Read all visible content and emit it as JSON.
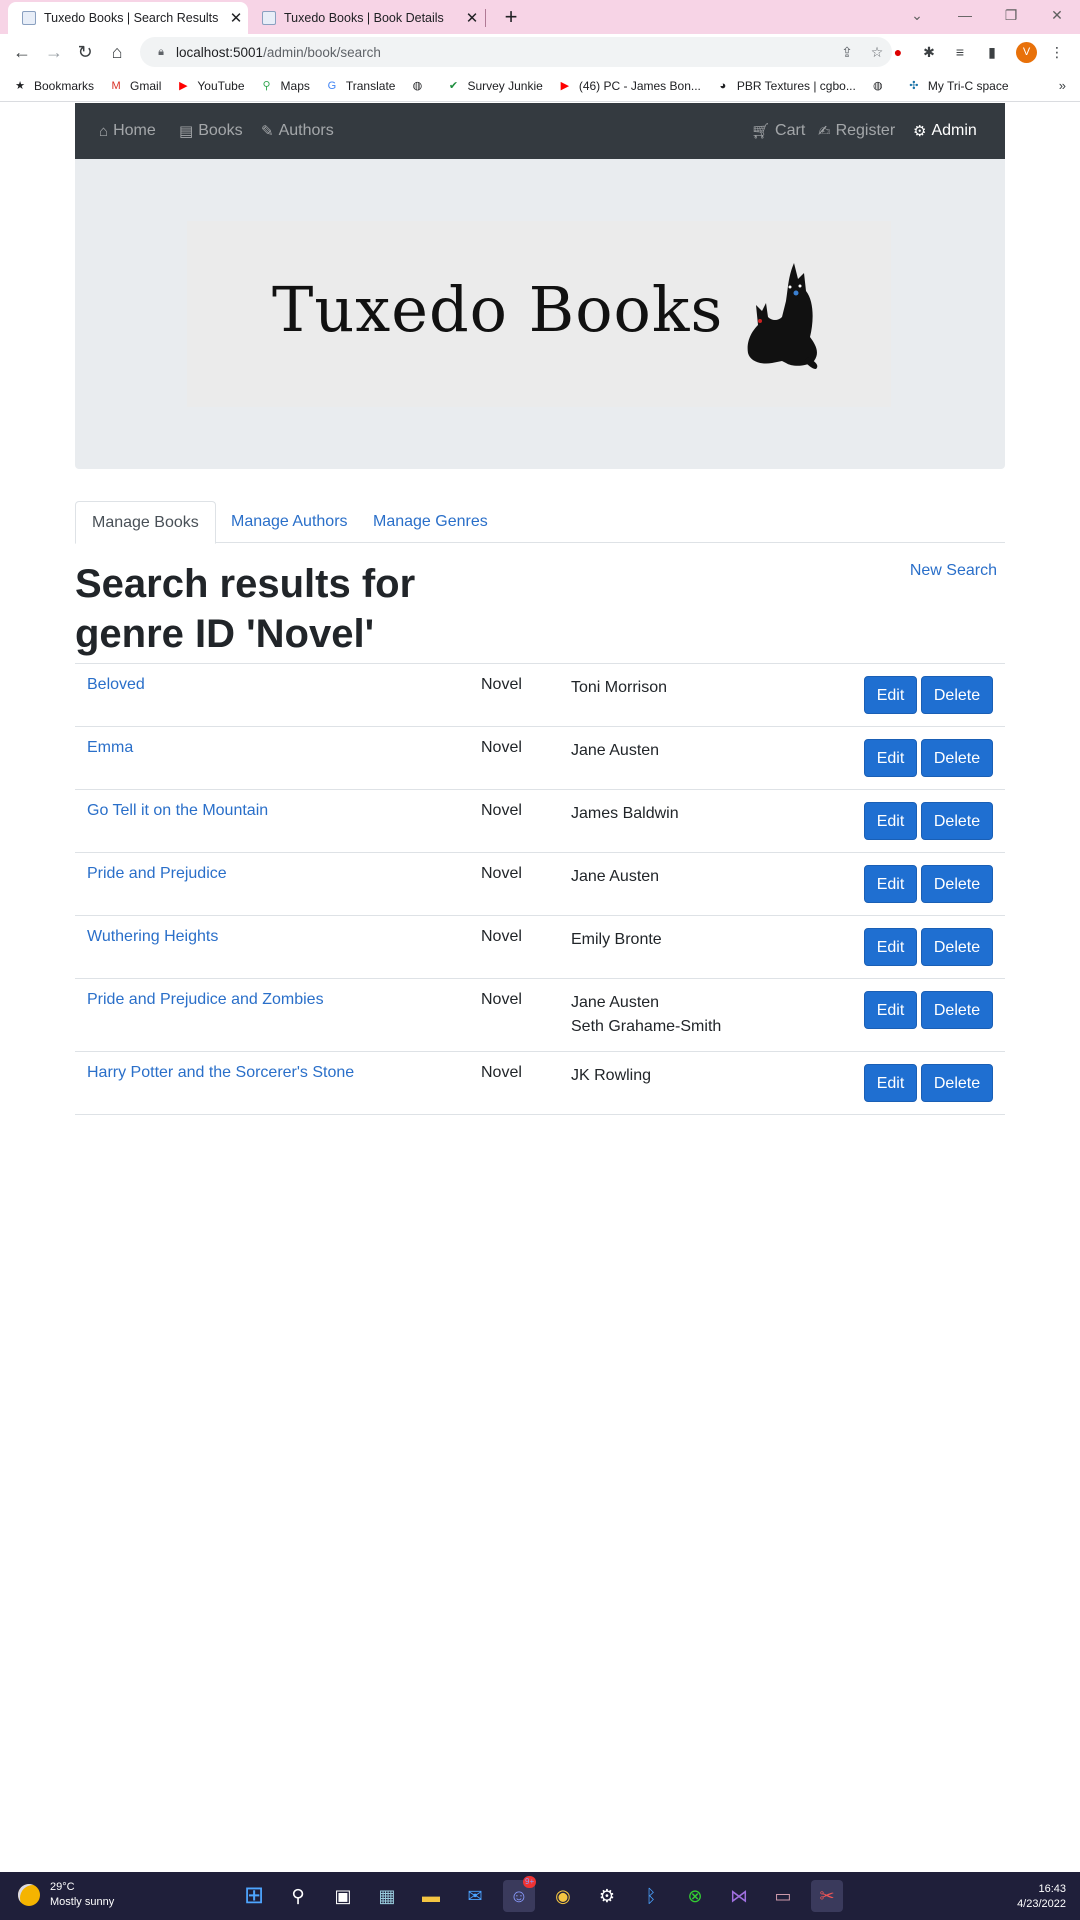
{
  "browser": {
    "tabs": [
      {
        "title": "Tuxedo Books | Search Results",
        "active": true
      },
      {
        "title": "Tuxedo Books | Book Details",
        "active": false
      }
    ],
    "new_tab": "+",
    "url_host": "localhost:5001",
    "url_path": "/admin/book/search",
    "profile_initial": "V",
    "bookmarks": [
      {
        "label": "Bookmarks",
        "icon": "star-icon"
      },
      {
        "label": "Gmail",
        "icon": "gmail-icon"
      },
      {
        "label": "YouTube",
        "icon": "youtube-icon"
      },
      {
        "label": "Maps",
        "icon": "maps-icon"
      },
      {
        "label": "Translate",
        "icon": "translate-icon"
      },
      {
        "label": "",
        "icon": "globe-icon"
      },
      {
        "label": "Survey Junkie",
        "icon": "check-icon"
      },
      {
        "label": "(46) PC - James Bon...",
        "icon": "youtube-icon"
      },
      {
        "label": "PBR Textures | cgbo...",
        "icon": "palette-icon"
      },
      {
        "label": "",
        "icon": "globe-icon"
      },
      {
        "label": "My Tri-C space",
        "icon": "tri-c-icon"
      }
    ],
    "bookmarks_more": "»"
  },
  "navbar": {
    "home": "Home",
    "books": "Books",
    "authors": "Authors",
    "cart": "Cart",
    "register": "Register",
    "admin": "Admin"
  },
  "logo": {
    "text": "Tuxedo Books"
  },
  "admin_tabs": {
    "manage_books": "Manage Books",
    "manage_authors": "Manage Authors",
    "manage_genres": "Manage Genres"
  },
  "heading": "Search results for genre ID 'Novel'",
  "new_search": "New Search",
  "buttons": {
    "edit": "Edit",
    "delete": "Delete"
  },
  "results": [
    {
      "title": "Beloved",
      "genre": "Novel",
      "authors": [
        "Toni Morrison"
      ]
    },
    {
      "title": "Emma",
      "genre": "Novel",
      "authors": [
        "Jane Austen"
      ]
    },
    {
      "title": "Go Tell it on the Mountain",
      "genre": "Novel",
      "authors": [
        "James Baldwin"
      ]
    },
    {
      "title": "Pride and Prejudice",
      "genre": "Novel",
      "authors": [
        "Jane Austen"
      ]
    },
    {
      "title": "Wuthering Heights",
      "genre": "Novel",
      "authors": [
        "Emily Bronte"
      ]
    },
    {
      "title": "Pride and Prejudice and Zombies",
      "genre": "Novel",
      "authors": [
        "Jane Austen",
        "Seth Grahame-Smith"
      ]
    },
    {
      "title": "Harry Potter and the Sorcerer's Stone",
      "genre": "Novel",
      "authors": [
        "JK Rowling"
      ]
    }
  ],
  "taskbar": {
    "temperature": "29°C",
    "weather": "Mostly sunny",
    "time": "16:43",
    "date": "4/23/2022",
    "discord_badge": "9+"
  },
  "colors": {
    "link": "#2a6fc9",
    "button": "#1f6fd1",
    "navbar": "#343a40",
    "tabstrip": "#f7d4e6"
  }
}
